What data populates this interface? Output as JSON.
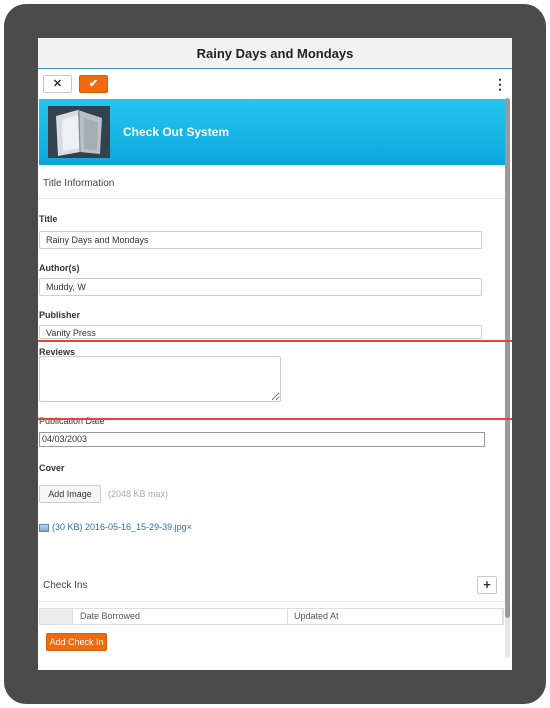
{
  "window": {
    "title": "Rainy Days and Mondays"
  },
  "toolbar": {
    "cancel_icon": "close-icon",
    "save_icon": "check-icon",
    "menu_icon": "more-vertical-icon",
    "cancel_glyph": "✕",
    "save_glyph": "✔",
    "menu_glyph": "⋮"
  },
  "banner": {
    "title": "Check Out System",
    "color": "#13b4e6"
  },
  "sections": {
    "title_info": "Title Information",
    "check_ins": "Check Ins"
  },
  "fields": {
    "title": {
      "label": "Title",
      "value": "Rainy Days and Mondays"
    },
    "authors": {
      "label": "Author(s)",
      "value": "Muddy, W"
    },
    "publisher": {
      "label": "Publisher",
      "value": "Vanity Press"
    },
    "reviews": {
      "label": "Reviews",
      "value": ""
    },
    "publication_date": {
      "label": "Publication Date",
      "value": "04/03/2003"
    },
    "cover": {
      "label": "Cover",
      "add_button": "Add Image",
      "max_note": "(2048 KB max)"
    }
  },
  "attachment": {
    "icon": "image-file-icon",
    "text": "(30 KB) 2016-05-16_15-29-39.jpg",
    "remove": "×"
  },
  "check_ins": {
    "add_glyph": "+",
    "columns": [
      "Date Borrowed",
      "Updated At"
    ],
    "add_button": "Add Check In"
  },
  "colors": {
    "accent": "#f26a10",
    "link": "#2a6fb3",
    "highlight": "#e0463b"
  }
}
